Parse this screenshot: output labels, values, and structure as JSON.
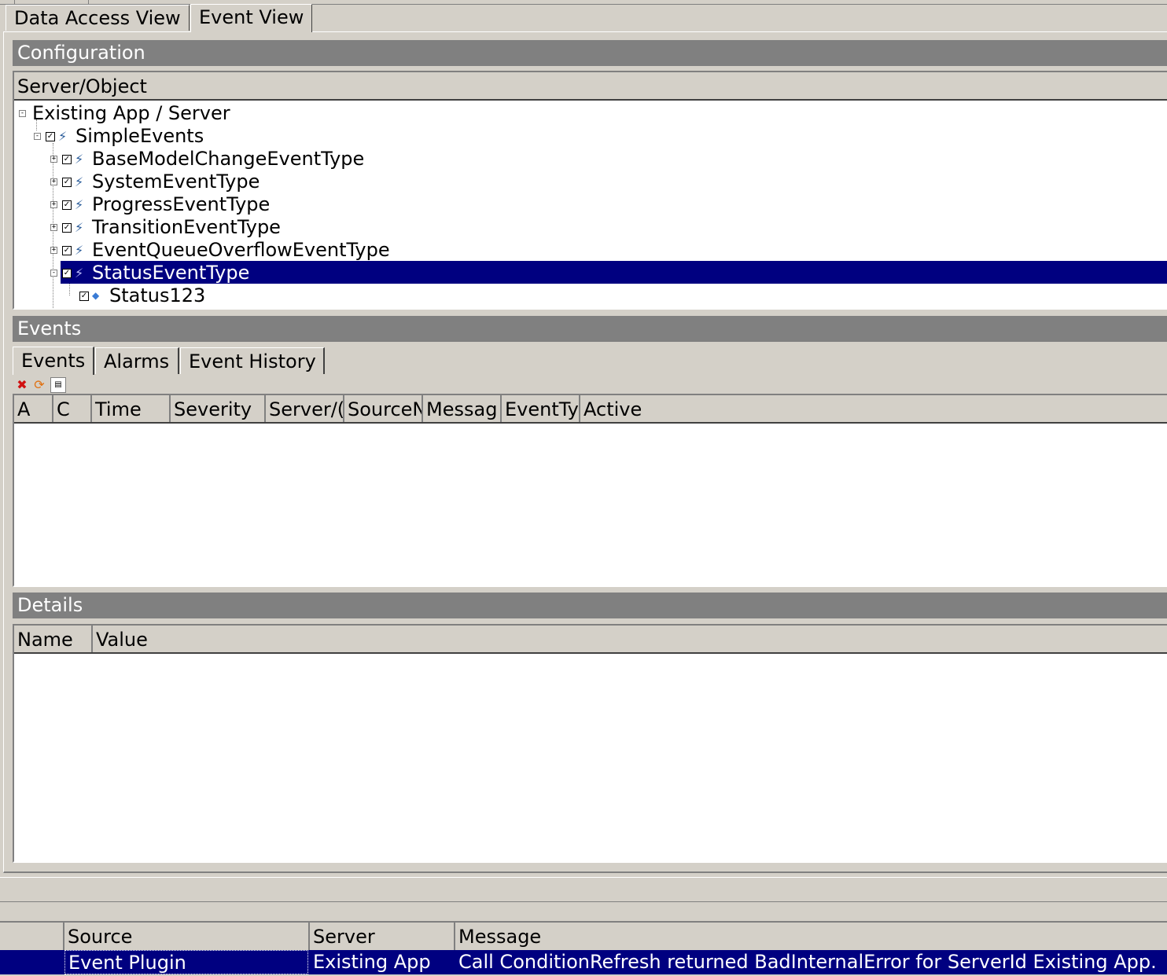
{
  "tabs": [
    "Data Access View",
    "Event View"
  ],
  "configuration": {
    "header": "Configuration",
    "column": "Server/Object",
    "tree": [
      {
        "label": "Existing App / Server",
        "checked": false,
        "icon": "",
        "expander": "-"
      },
      {
        "label": "SimpleEvents",
        "checked": true,
        "icon": "event-type-icon",
        "expander": "-"
      },
      {
        "label": "BaseModelChangeEventType",
        "checked": true,
        "icon": "event-type-icon",
        "expander": "+"
      },
      {
        "label": "SystemEventType",
        "checked": true,
        "icon": "event-type-icon",
        "expander": "+"
      },
      {
        "label": "ProgressEventType",
        "checked": true,
        "icon": "event-type-icon",
        "expander": "+"
      },
      {
        "label": "TransitionEventType",
        "checked": true,
        "icon": "event-type-icon",
        "expander": "+"
      },
      {
        "label": "EventQueueOverflowEventType",
        "checked": true,
        "icon": "event-type-icon",
        "expander": "+"
      },
      {
        "label": "StatusEventType",
        "checked": true,
        "icon": "event-type-icon",
        "expander": "-",
        "selected": true
      },
      {
        "label": "Status123",
        "checked": true,
        "icon": "variable-dot-icon",
        "expander": ""
      }
    ]
  },
  "events": {
    "header": "Events",
    "tabs": [
      "Events",
      "Alarms",
      "Event History"
    ],
    "toolbar": {
      "delete_icon": "delete-icon",
      "refresh_icon": "refresh-icon",
      "columns_icon": "columns-icon"
    },
    "columns": [
      "A",
      "C",
      "Time",
      "Severity",
      "Server/(",
      "SourceN",
      "Messag",
      "EventTy",
      "Active"
    ]
  },
  "details": {
    "header": "Details",
    "columns": [
      "Name",
      "Value"
    ]
  },
  "log": {
    "columns": [
      "Source",
      "Server",
      "Message"
    ],
    "rows": [
      {
        "source": "Event Plugin",
        "server": "Existing App",
        "message": "Call ConditionRefresh returned BadInternalError for ServerId Existing App."
      }
    ]
  }
}
